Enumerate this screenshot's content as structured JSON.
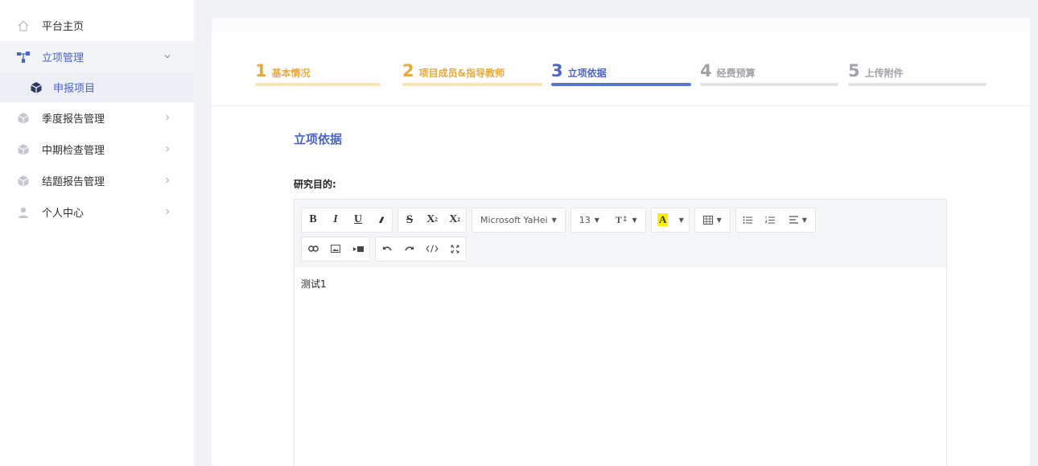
{
  "sidebar": {
    "items": [
      {
        "label": "平台主页",
        "icon": "home-icon"
      },
      {
        "label": "立项管理",
        "icon": "org-chart-icon",
        "expanded": true
      },
      {
        "label": "申报项目",
        "icon": "cube-icon",
        "sub": true
      },
      {
        "label": "季度报告管理",
        "icon": "cube-icon"
      },
      {
        "label": "中期检查管理",
        "icon": "cube-icon"
      },
      {
        "label": "结题报告管理",
        "icon": "cube-icon"
      },
      {
        "label": "个人中心",
        "icon": "user-icon"
      }
    ]
  },
  "steps": [
    {
      "num": "1",
      "label": "基本情况",
      "state": "done"
    },
    {
      "num": "2",
      "label": "项目成员&指导教师",
      "state": "done"
    },
    {
      "num": "3",
      "label": "立项依据",
      "state": "current"
    },
    {
      "num": "4",
      "label": "经费预算",
      "state": "todo"
    },
    {
      "num": "5",
      "label": "上传附件",
      "state": "todo"
    }
  ],
  "section": {
    "title": "立项依据"
  },
  "field": {
    "label": "研究目的:"
  },
  "editor": {
    "toolbar": {
      "bold": "B",
      "italic": "I",
      "underline": "U",
      "strike": "S",
      "superscript": "X",
      "subscript": "X",
      "font_family": "Microsoft YaHei",
      "font_size": "13",
      "line_height": "T",
      "fore_color": "A"
    },
    "content": "测试1"
  },
  "colors": {
    "accent": "#4a64c9",
    "done": "#e8a93a",
    "todo": "#a0a3a8"
  }
}
